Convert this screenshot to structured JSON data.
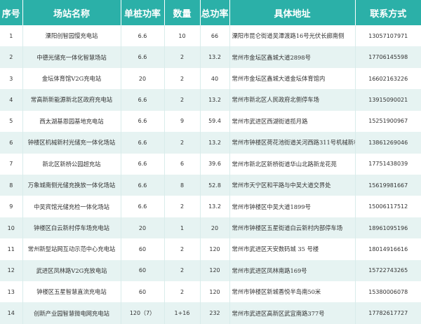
{
  "headers": [
    "序号",
    "场站名称",
    "单桩功率",
    "数量",
    "总功率",
    "具体地址",
    "联系方式"
  ],
  "rows": [
    {
      "no": "1",
      "name": "溧阳创智园慢充电站",
      "power": "6.6",
      "qty": "10",
      "total": "66",
      "address": "溧阳市昆仑街道吴潭渡路16号光伏长廊南侧",
      "phone": "13057107971"
    },
    {
      "no": "2",
      "name": "中德光储充一体化智慧场站",
      "power": "6.6",
      "qty": "2",
      "total": "13.2",
      "address": "常州市金坛区鑫城大道2898号",
      "phone": "17706145598"
    },
    {
      "no": "3",
      "name": "金坛体育馆V2G充电站",
      "power": "20",
      "qty": "2",
      "total": "40",
      "address": "常州市金坛区鑫城大道金坛体育馆内",
      "phone": "16602163226"
    },
    {
      "no": "4",
      "name": "常高新新能源新北区政府充电站",
      "power": "6.6",
      "qty": "2",
      "total": "13.2",
      "address": "常州市新北区人民政府北侧停车场",
      "phone": "13915090021"
    },
    {
      "no": "5",
      "name": "西太湖基恩园基地充电站",
      "power": "6.6",
      "qty": "9",
      "total": "59.4",
      "address": "常州市武进区西湖街道揽月路",
      "phone": "15251900967"
    },
    {
      "no": "6",
      "name": "钟楼区机械新村光储充一体化场站",
      "power": "6.6",
      "qty": "2",
      "total": "13.2",
      "address": "常州市钟楼区荷花池街道关河西路311号机械新村西区",
      "phone": "13861269046"
    },
    {
      "no": "7",
      "name": "新北区新桥公园超充站",
      "power": "6.6",
      "qty": "6",
      "total": "39.6",
      "address": "常州市新北区新桥街道华山北路新龙花苑",
      "phone": "17751438039"
    },
    {
      "no": "8",
      "name": "万象城南侧光储充换放一体化场站",
      "power": "6.6",
      "qty": "8",
      "total": "52.8",
      "address": "常州市天宁区和平路与中吴大道交界处",
      "phone": "15619981667"
    },
    {
      "no": "9",
      "name": "中吴宾馆光储充检一体化场站",
      "power": "6.6",
      "qty": "2",
      "total": "13.2",
      "address": "常州市钟楼区中吴大道1899号",
      "phone": "15006117512"
    },
    {
      "no": "10",
      "name": "钟楼区白云新村停车场充电站",
      "power": "20",
      "qty": "1",
      "total": "20",
      "address": "常州市钟楼区五星街道白云新村内部停车场",
      "phone": "18961095196"
    },
    {
      "no": "11",
      "name": "常州新型站网互动示范中心充电站",
      "power": "60",
      "qty": "2",
      "total": "120",
      "address": "常州市武进区天安数码城 35 号楼",
      "phone": "18014916616"
    },
    {
      "no": "12",
      "name": "武进区凤林路V2G充放电站",
      "power": "60",
      "qty": "2",
      "total": "120",
      "address": "常州市武进区凤林南路169号",
      "phone": "15722743265"
    },
    {
      "no": "13",
      "name": "钟楼区五星智慧直流充电站",
      "power": "60",
      "qty": "2",
      "total": "120",
      "address": "常州市钟楼区新城香悦半岛南50米",
      "phone": "15380006078"
    },
    {
      "no": "14",
      "name": "创新产业园智慧微电网充电站",
      "power": "120（7）",
      "qty": "1+16",
      "total": "232",
      "address": "常州市武进区高新区武宜南路377号",
      "phone": "17782617727"
    }
  ],
  "colors": {
    "header_bg": "#2bb0a8",
    "header_text": "#ffffff",
    "row_alt": "#e6f3f2",
    "border": "#d9eceb"
  }
}
